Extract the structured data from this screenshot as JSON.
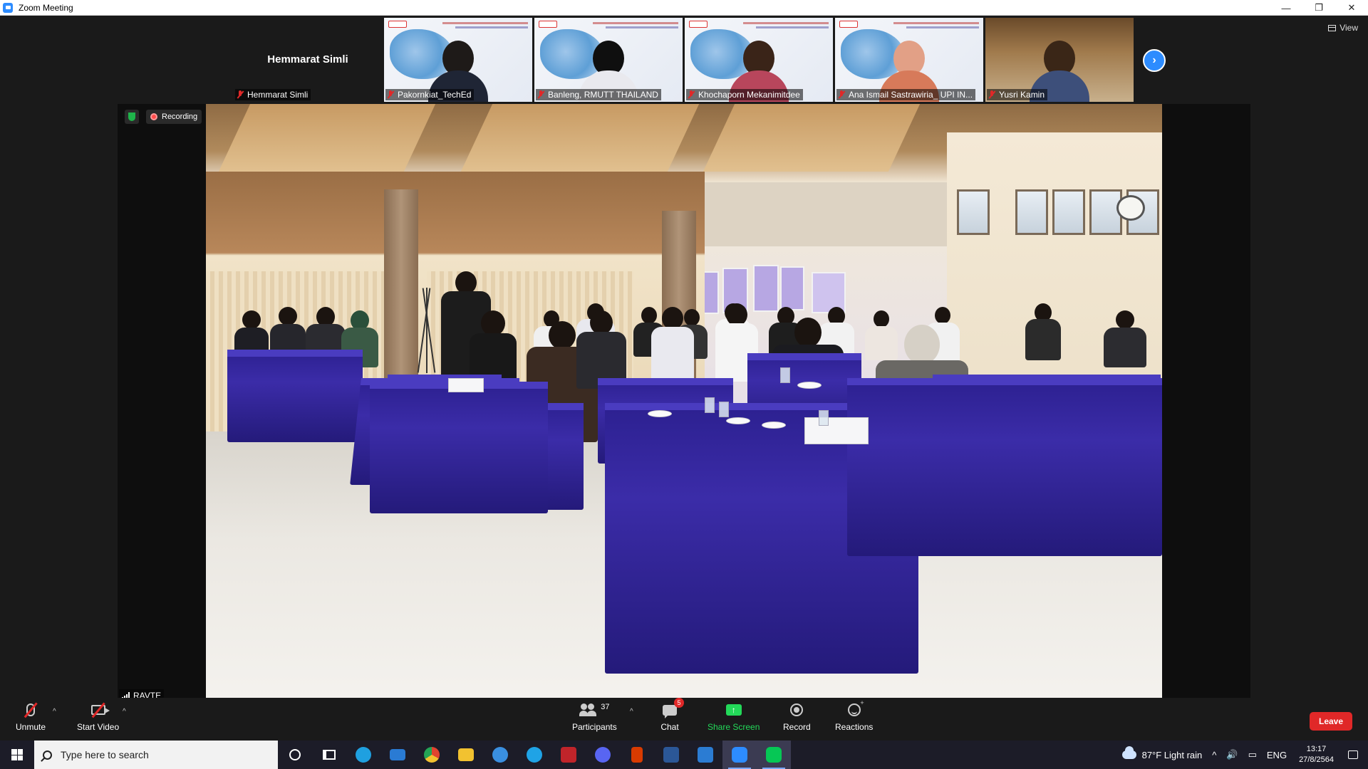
{
  "window": {
    "title": "Zoom Meeting",
    "minimize": "—",
    "restore": "❐",
    "close": "✕"
  },
  "view_button": "View",
  "gallery": {
    "name_only_big": "Hemmarat Simli",
    "tiles": [
      {
        "name": "Hemmarat Simli"
      },
      {
        "name": "Pakornkiat_TechEd"
      },
      {
        "name": "Banleng, RMUTT THAILAND"
      },
      {
        "name": "Khochaporn Mekanimitdee"
      },
      {
        "name": "Ana Ismail Sastrawiria_ UPI IN..."
      },
      {
        "name": "Yusri Kamin"
      }
    ],
    "next_arrow": "›"
  },
  "main_video": {
    "recording_label": "Recording",
    "feed_name": "RAVTE"
  },
  "controls": {
    "unmute": "Unmute",
    "start_video": "Start Video",
    "participants": "Participants",
    "participants_count": "37",
    "chat": "Chat",
    "chat_badge": "5",
    "share_screen": "Share Screen",
    "share_arrow": "↑",
    "record": "Record",
    "reactions": "Reactions",
    "reactions_plus": "+",
    "caret": "^",
    "leave": "Leave"
  },
  "taskbar": {
    "search_placeholder": "Type here to search",
    "weather": "87°F  Light rain",
    "tray_up": "^",
    "speaker": "🔊",
    "network": "▭",
    "language": "ENG",
    "time": "13:17",
    "date": "27/8/2564",
    "icons": [
      {
        "name": "cortana-icon"
      },
      {
        "name": "task-view-icon"
      },
      {
        "name": "edge-icon",
        "color": "#1fa0e0"
      },
      {
        "name": "mail-icon",
        "color": "#2a7bd4"
      },
      {
        "name": "chrome-icon",
        "color": "#e8b120"
      },
      {
        "name": "file-explorer-icon",
        "color": "#f2c230"
      },
      {
        "name": "app-icon",
        "color": "#3a8fe0"
      },
      {
        "name": "skype-icon",
        "color": "#1fa3e6"
      },
      {
        "name": "game-icon",
        "color": "#c0242a"
      },
      {
        "name": "discord-icon",
        "color": "#5865f2"
      },
      {
        "name": "office-icon",
        "color": "#d83b01"
      },
      {
        "name": "word-icon",
        "color": "#2b5797"
      },
      {
        "name": "word-doc-icon",
        "color": "#2b7cd3"
      },
      {
        "name": "zoom-icon",
        "color": "#2d8cff"
      },
      {
        "name": "line-icon",
        "color": "#06c755"
      }
    ]
  },
  "colors": {
    "accent": "#2d8cff",
    "leave": "#e02828",
    "share": "#23d959",
    "muted": "#e02828"
  }
}
